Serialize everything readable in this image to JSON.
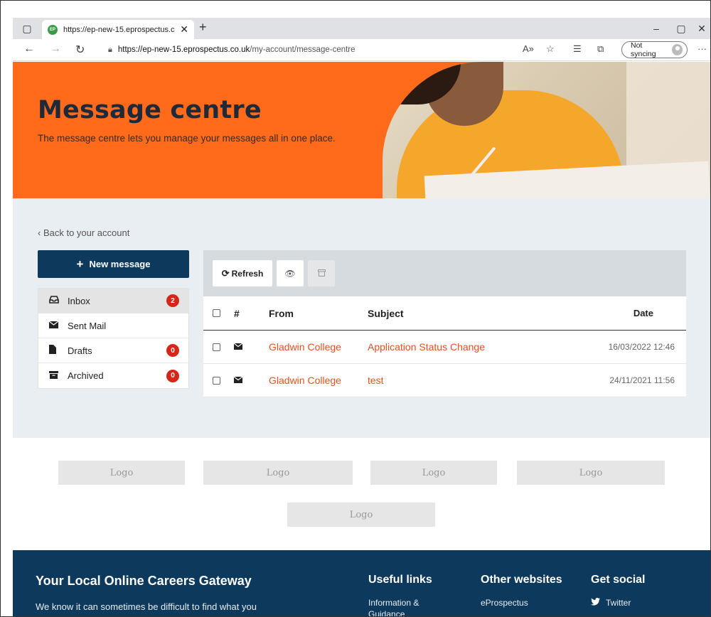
{
  "browser": {
    "tab_title": "https://ep-new-15.eprospectus.c",
    "tab_favicon": "EP",
    "url_host": "https://ep-new-15.eprospectus.co.uk",
    "url_path": "/my-account/message-centre",
    "sync_label": "Not syncing"
  },
  "hero": {
    "title": "Message centre",
    "subtitle": "The message centre lets you manage your messages all in one place."
  },
  "back_link": "‹ Back to your account",
  "new_message_label": "New message",
  "folders": [
    {
      "label": "Inbox",
      "icon": "inbox-icon",
      "count": "2"
    },
    {
      "label": "Sent Mail",
      "icon": "envelope-icon",
      "count": ""
    },
    {
      "label": "Drafts",
      "icon": "file-icon",
      "count": "0"
    },
    {
      "label": "Archived",
      "icon": "archive-icon",
      "count": "0"
    }
  ],
  "toolbar": {
    "refresh_label": "Refresh"
  },
  "table": {
    "headers": {
      "num": "#",
      "from": "From",
      "subject": "Subject",
      "date": "Date"
    },
    "rows": [
      {
        "from": "Gladwin College",
        "subject": "Application Status Change",
        "date": "16/03/2022 12:46"
      },
      {
        "from": "Gladwin College",
        "subject": "test",
        "date": "24/11/2021 11:56"
      }
    ]
  },
  "logos": [
    "Logo",
    "Logo",
    "Logo",
    "Logo",
    "Logo"
  ],
  "footer": {
    "heading": "Your Local Online Careers Gateway",
    "description": "We know it can sometimes be difficult to find what you",
    "useful_links": {
      "title": "Useful links",
      "item": "Information & Guidance"
    },
    "other_websites": {
      "title": "Other websites",
      "item": "eProspectus"
    },
    "get_social": {
      "title": "Get social",
      "item": "Twitter"
    }
  },
  "colors": {
    "hero_orange": "#ff6b1a",
    "navy": "#0d3a5c",
    "link_orange": "#e8501f",
    "badge_red": "#d6261a"
  }
}
